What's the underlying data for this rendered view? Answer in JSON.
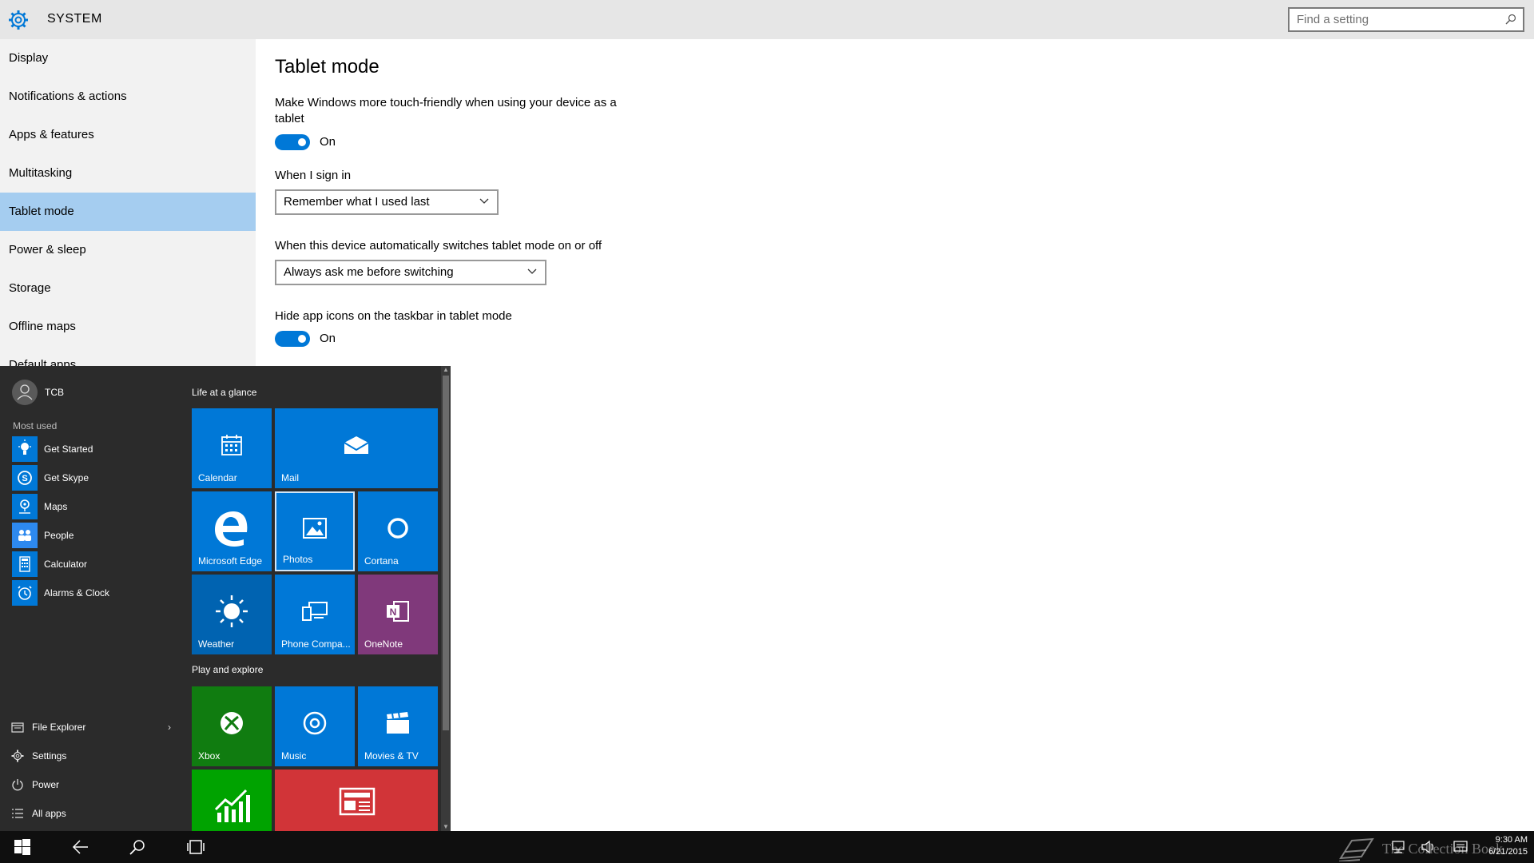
{
  "titlebar": {
    "title": "SYSTEM",
    "search_placeholder": "Find a setting"
  },
  "sidebar": {
    "items": [
      {
        "label": "Display",
        "selected": false
      },
      {
        "label": "Notifications & actions",
        "selected": false
      },
      {
        "label": "Apps & features",
        "selected": false
      },
      {
        "label": "Multitasking",
        "selected": false
      },
      {
        "label": "Tablet mode",
        "selected": true
      },
      {
        "label": "Power & sleep",
        "selected": false
      },
      {
        "label": "Storage",
        "selected": false
      },
      {
        "label": "Offline maps",
        "selected": false
      },
      {
        "label": "Default apps",
        "selected": false
      }
    ]
  },
  "main": {
    "heading": "Tablet mode",
    "touch_desc": "Make Windows more touch-friendly when using your device as a tablet",
    "touch_toggle": "On",
    "signin_label": "When I sign in",
    "signin_value": "Remember what I used last",
    "switch_label": "When this device automatically switches tablet mode on or off",
    "switch_value": "Always ask me before switching",
    "hide_icons_label": "Hide app icons on the taskbar in tablet mode",
    "hide_icons_toggle": "On"
  },
  "start_menu": {
    "user": "TCB",
    "most_used_label": "Most used",
    "most_used": [
      {
        "label": "Get Started",
        "icon": "lightbulb-icon"
      },
      {
        "label": "Get Skype",
        "icon": "skype-icon"
      },
      {
        "label": "Maps",
        "icon": "maps-icon"
      },
      {
        "label": "People",
        "icon": "people-icon"
      },
      {
        "label": "Calculator",
        "icon": "calculator-icon"
      },
      {
        "label": "Alarms & Clock",
        "icon": "alarm-clock-icon"
      }
    ],
    "bottom": {
      "file_explorer": "File Explorer",
      "settings": "Settings",
      "power": "Power",
      "all_apps": "All apps"
    },
    "groups": {
      "life": "Life at a glance",
      "play": "Play and explore"
    },
    "tiles": {
      "calendar": "Calendar",
      "mail": "Mail",
      "edge": "Microsoft Edge",
      "photos": "Photos",
      "cortana": "Cortana",
      "weather": "Weather",
      "phone": "Phone Compa...",
      "onenote": "OneNote",
      "xbox": "Xbox",
      "music": "Music",
      "movies": "Movies & TV"
    },
    "colors": {
      "tile_blue": "#0078d7",
      "tile_dark_blue": "#0063b1",
      "onenote": "#80397b",
      "xbox": "#107c10",
      "money": "#00a300",
      "news": "#d13438"
    }
  },
  "taskbar": {
    "time": "9:30 AM",
    "date": "6/21/2015",
    "watermark": "The Collection Book"
  }
}
